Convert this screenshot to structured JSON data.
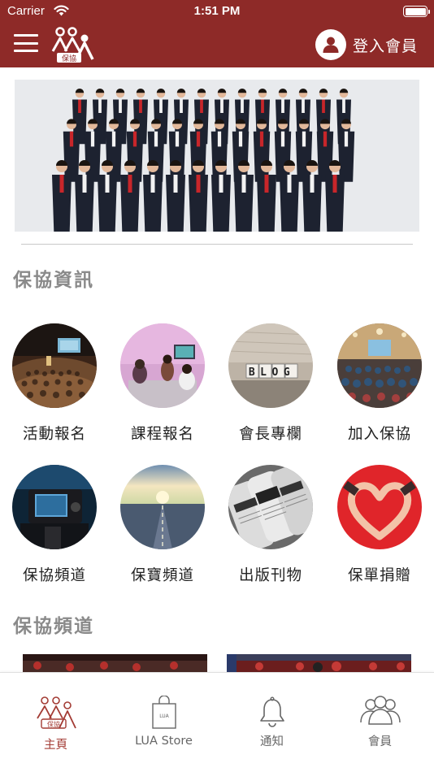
{
  "status_bar": {
    "carrier": "Carrier",
    "time": "1:51 PM"
  },
  "nav": {
    "logo_text": "保協",
    "login_label": "登入會員"
  },
  "sections": {
    "info_title": "保協資訊",
    "channel_title": "保協頻道"
  },
  "grid": [
    {
      "label": "活動報名",
      "icon": "event-photo"
    },
    {
      "label": "課程報名",
      "icon": "class-photo"
    },
    {
      "label": "會長專欄",
      "icon": "blog-photo"
    },
    {
      "label": "加入保協",
      "icon": "hall-photo"
    },
    {
      "label": "保協頻道",
      "icon": "camera-photo"
    },
    {
      "label": "保寶頻道",
      "icon": "road-photo"
    },
    {
      "label": "出版刊物",
      "icon": "newspaper-photo"
    },
    {
      "label": "保單捐贈",
      "icon": "heart-hands-photo"
    }
  ],
  "blog_sign": "BLOG",
  "tabs": [
    {
      "label": "主頁",
      "icon": "home-logo-icon",
      "active": true
    },
    {
      "label": "LUA Store",
      "icon": "shopping-bag-icon",
      "bag_text": "LUA"
    },
    {
      "label": "通知",
      "icon": "bell-icon"
    },
    {
      "label": "會員",
      "icon": "members-icon"
    }
  ],
  "colors": {
    "brand": "#8e2a28",
    "active_tab": "#a33b34",
    "section_title": "#8a8a8a"
  }
}
